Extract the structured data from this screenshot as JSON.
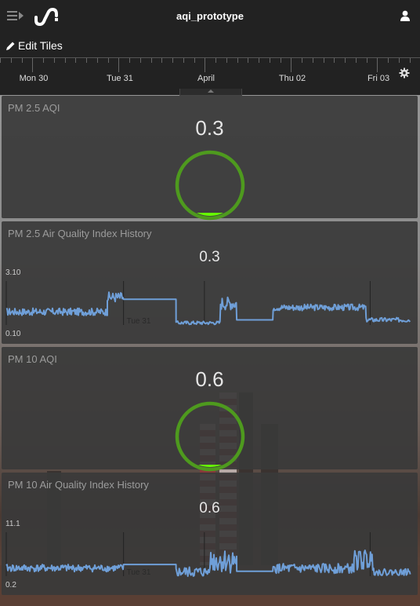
{
  "header": {
    "title": "aqi_prototype",
    "menu_icon": "hamburger-menu-icon",
    "logo_icon": "wave-logo-icon",
    "user_icon": "user-icon"
  },
  "toolbar": {
    "edit_label": "Edit Tiles",
    "edit_icon": "pencil-icon"
  },
  "timeline": {
    "days": [
      "Mon 30",
      "Tue 31",
      "April",
      "Thu 02",
      "Fri 03"
    ],
    "settings_icon": "gear-icon"
  },
  "tiles": [
    {
      "title": "PM 2.5 AQI",
      "value": "0.3",
      "gauge_color": "#4e9a1e",
      "fill_color": "#66ff00",
      "fill_fraction": 0.05
    },
    {
      "title": "PM 2.5 Air Quality Index History",
      "value": "0.3",
      "y_max_label": "3.10",
      "y_min_label": "0.10",
      "marker_label": "Tue 31",
      "line_color": "#6f9fd8"
    },
    {
      "title": "PM 10 AQI",
      "value": "0.6",
      "gauge_color": "#4e9a1e",
      "fill_color": "#66ff00",
      "fill_fraction": 0.03
    },
    {
      "title": "PM 10 Air Quality Index History",
      "value": "0.6",
      "y_max_label": "11.1",
      "y_min_label": "0.2",
      "marker_label": "Tue 31",
      "line_color": "#6f9fd8"
    }
  ],
  "chart_data": [
    {
      "type": "line",
      "title": "PM 2.5 Air Quality Index History",
      "ylim": [
        0.1,
        3.1
      ],
      "x_labels": [
        "Mon 30",
        "Tue 31",
        "April",
        "Thu 02",
        "Fri 03"
      ],
      "segments": [
        {
          "x": [
            0.0,
            0.25
          ],
          "level": 1.0,
          "noise": 0.25
        },
        {
          "x": [
            0.25,
            0.29
          ],
          "level": 2.0,
          "noise": 0.35
        },
        {
          "x": [
            0.29,
            0.42
          ],
          "level": 1.85,
          "noise": 0.0
        },
        {
          "x": [
            0.42,
            0.53
          ],
          "level": 0.25,
          "noise": 0.12
        },
        {
          "x": [
            0.53,
            0.57
          ],
          "level": 1.6,
          "noise": 0.45
        },
        {
          "x": [
            0.57,
            0.66
          ],
          "level": 0.45,
          "noise": 0.0
        },
        {
          "x": [
            0.66,
            0.89
          ],
          "level": 1.3,
          "noise": 0.22
        },
        {
          "x": [
            0.89,
            1.0
          ],
          "level": 0.45,
          "noise": 0.15
        }
      ]
    },
    {
      "type": "line",
      "title": "PM 10 Air Quality Index History",
      "ylim": [
        0.2,
        11.1
      ],
      "x_labels": [
        "Mon 30",
        "Tue 31",
        "April",
        "Thu 02",
        "Fri 03"
      ],
      "segments": [
        {
          "x": [
            0.0,
            0.29
          ],
          "level": 2.2,
          "noise": 0.9
        },
        {
          "x": [
            0.29,
            0.42
          ],
          "level": 3.1,
          "noise": 0.0
        },
        {
          "x": [
            0.42,
            0.5
          ],
          "level": 1.2,
          "noise": 1.3
        },
        {
          "x": [
            0.5,
            0.57
          ],
          "level": 4.0,
          "noise": 3.0
        },
        {
          "x": [
            0.57,
            0.66
          ],
          "level": 1.4,
          "noise": 0.0
        },
        {
          "x": [
            0.66,
            0.86
          ],
          "level": 2.1,
          "noise": 1.2
        },
        {
          "x": [
            0.86,
            0.91
          ],
          "level": 4.2,
          "noise": 2.5
        },
        {
          "x": [
            0.91,
            1.0
          ],
          "level": 1.2,
          "noise": 0.8
        }
      ]
    }
  ]
}
